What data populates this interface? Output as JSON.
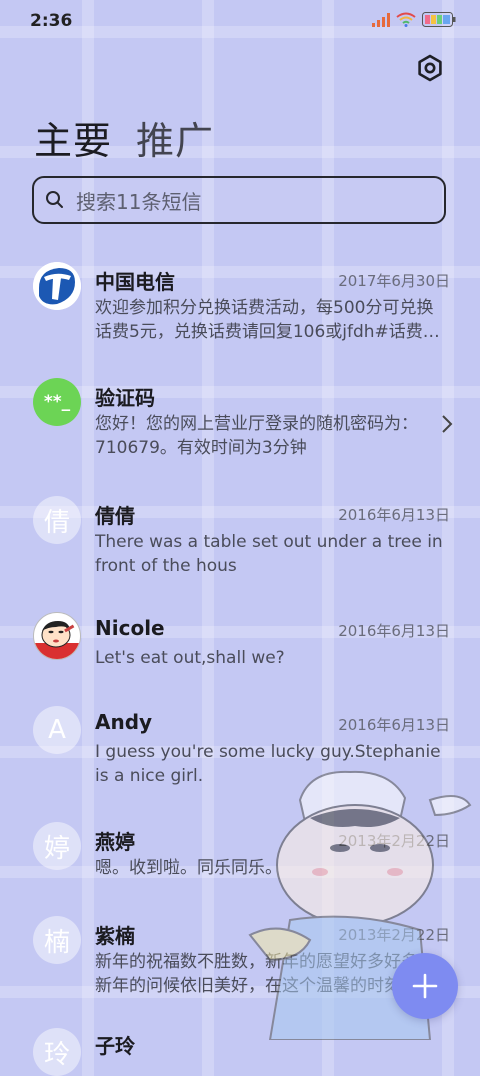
{
  "status_bar": {
    "time": "2:36",
    "icons": [
      "signal-icon",
      "wifi-icon",
      "battery-icon"
    ]
  },
  "header": {
    "settings_icon": "gear-icon",
    "tabs": [
      {
        "label": "主要",
        "active": true
      },
      {
        "label": "推广",
        "active": false
      }
    ]
  },
  "search": {
    "placeholder": "搜索11条短信"
  },
  "conversations": [
    {
      "name": "中国电信",
      "date": "2017年6月30日",
      "preview": "欢迎参加积分兑换话费活动，每500分可兑换话费5元，兑换话费请回复106或jfdh#话费…",
      "avatar": "china-telecom-logo"
    },
    {
      "name": "验证码",
      "date": "",
      "preview": "您好！您的网上营业厅登录的随机密码为：710679。有效时间为3分钟",
      "avatar": "verification-code-avatar",
      "avatar_text": "**_"
    },
    {
      "name": "倩倩",
      "date": "2016年6月13日",
      "preview": "There was a table set out under a tree in front of the hous",
      "avatar_text": "倩"
    },
    {
      "name": "Nicole",
      "date": "2016年6月13日",
      "preview": "Let's eat out,shall we?",
      "avatar": "cartoon-avatar"
    },
    {
      "name": "Andy",
      "date": "2016年6月13日",
      "preview": "I guess you're some lucky guy.Stephanie is a nice girl.",
      "avatar_text": "A"
    },
    {
      "name": "燕婷",
      "date": "2013年2月22日",
      "preview": "嗯。收到啦。同乐同乐。",
      "avatar_text": "婷"
    },
    {
      "name": "紫楠",
      "date": "2013年2月22日",
      "preview": "新年的祝福数不胜数，新年的愿望好多好多，新年的问候依旧美好，在这个温馨的时刻…",
      "avatar_text": "楠"
    },
    {
      "name": "子玲",
      "date": "",
      "preview": "",
      "avatar_text": "玲"
    }
  ],
  "fab": {
    "icon": "plus-icon"
  },
  "colors": {
    "background": "#c4c8f3",
    "accent": "#7e8bf1",
    "verification_avatar": "#6cd455"
  }
}
